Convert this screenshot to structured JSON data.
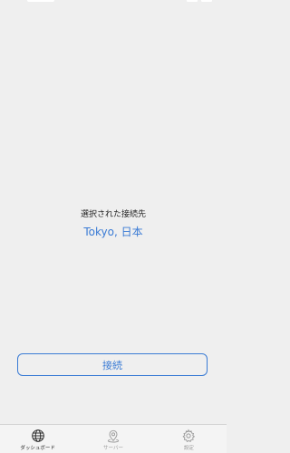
{
  "colors": {
    "accent": "#3a7bd5",
    "background": "#efefef",
    "tab_active": "#222222",
    "tab_inactive": "#9a9a9a"
  },
  "main": {
    "selected_label": "選択された接続先",
    "selected_value": "Tokyo, 日本",
    "connect_label": "接続"
  },
  "tab_bar": {
    "items": [
      {
        "label": "ダッシュボード",
        "icon": "globe-icon",
        "active": true
      },
      {
        "label": "サーバー",
        "icon": "map-pin-icon",
        "active": false
      },
      {
        "label": "設定",
        "icon": "gear-icon",
        "active": false
      }
    ]
  }
}
